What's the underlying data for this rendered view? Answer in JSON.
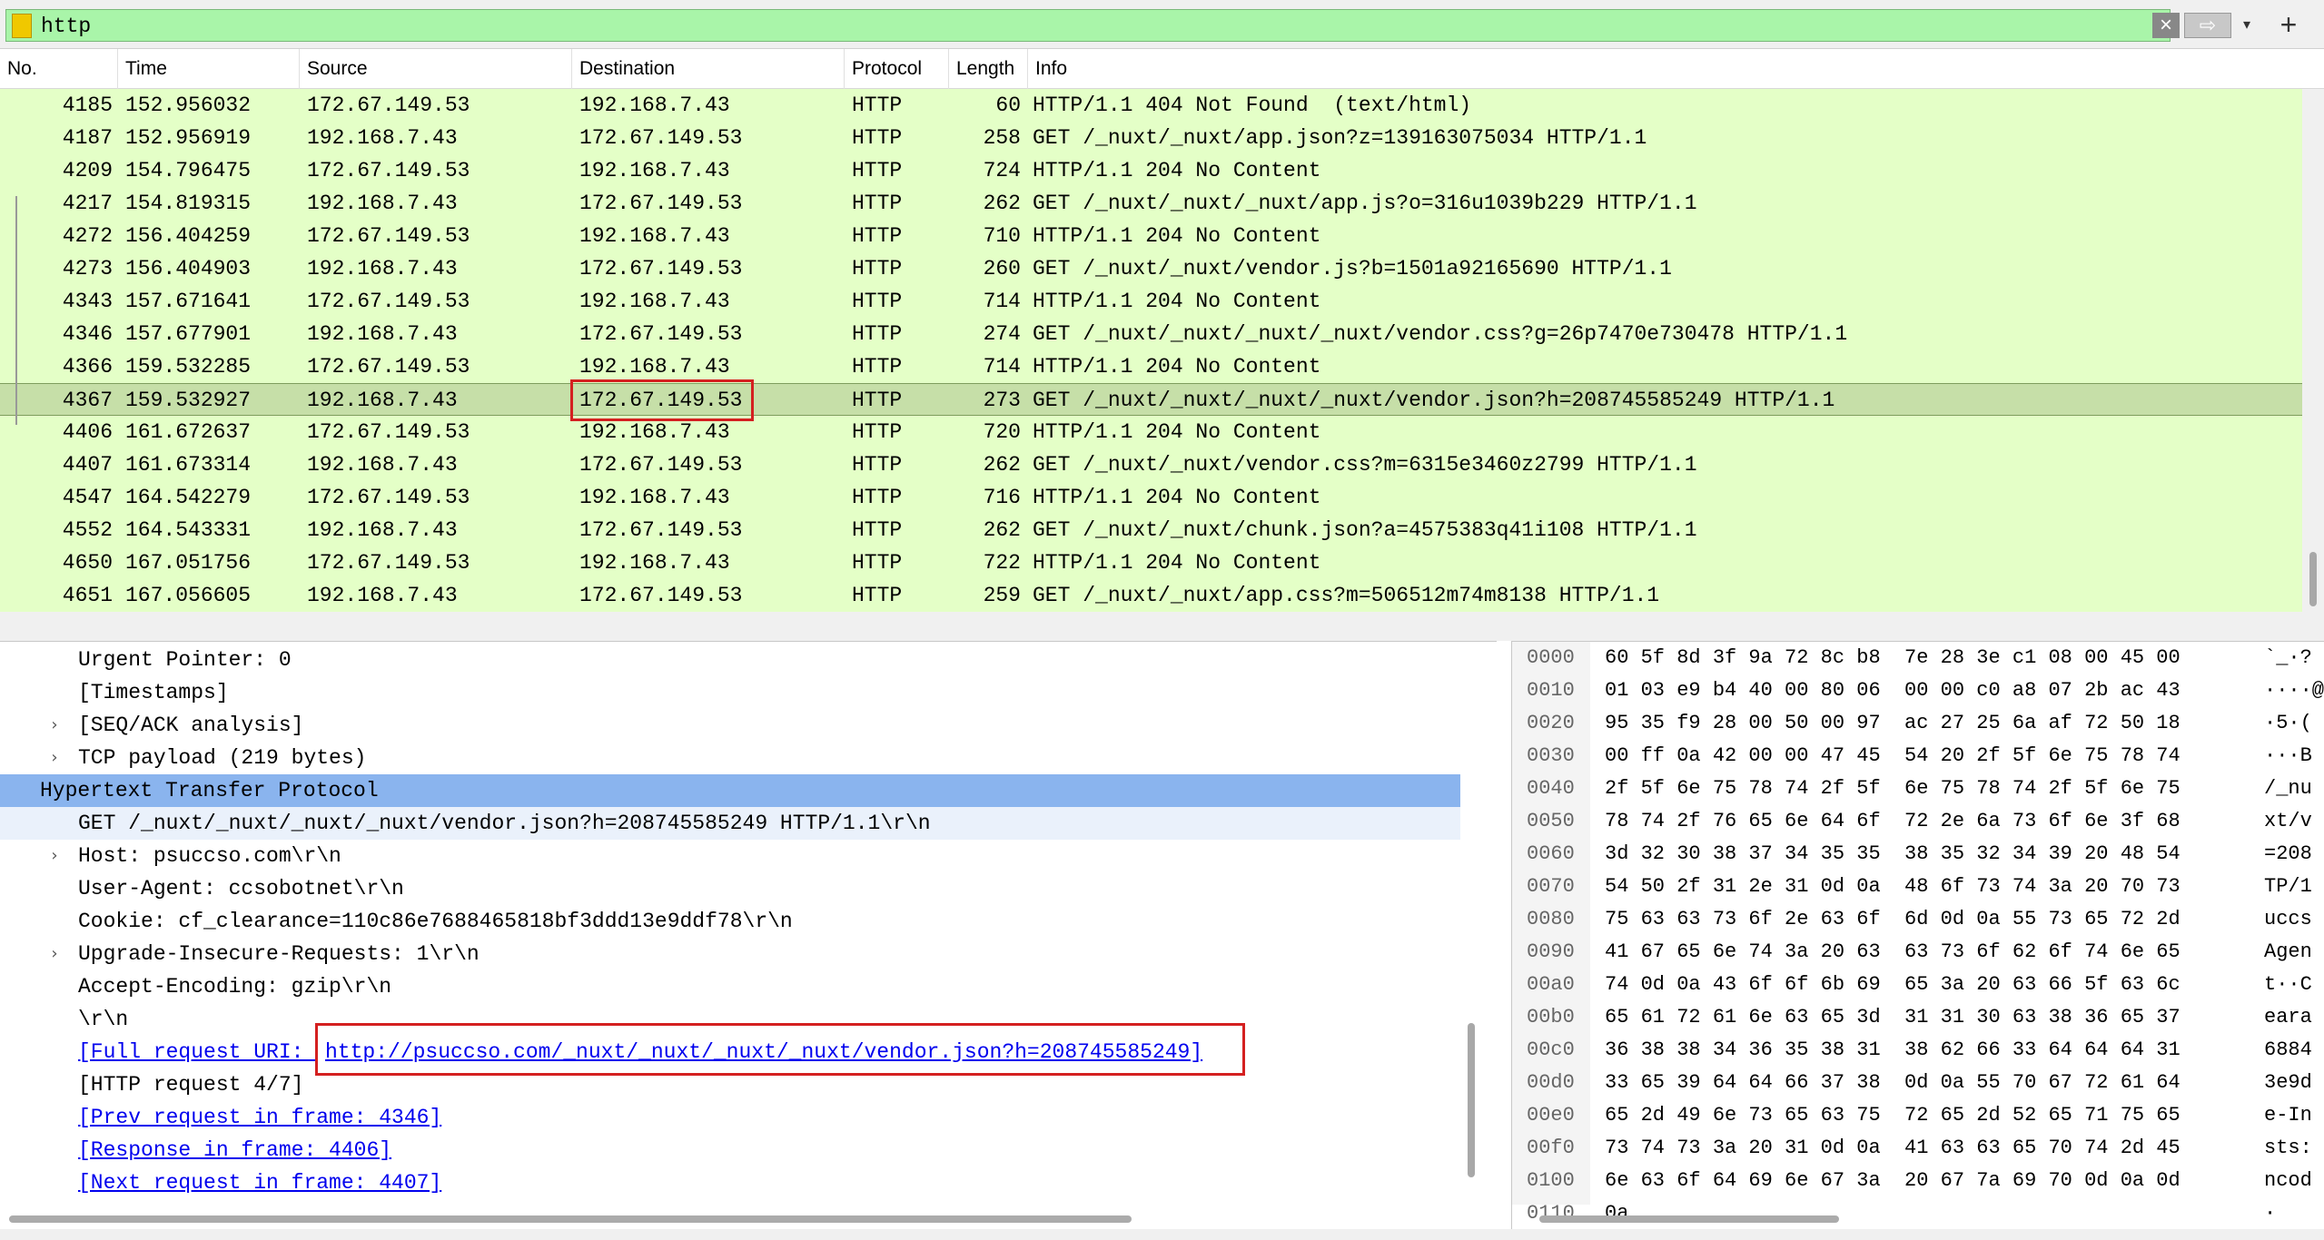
{
  "filter": {
    "value": "http",
    "clear_glyph": "×",
    "apply_glyph": "⇨",
    "dropdown_glyph": "▾",
    "add_glyph": "+"
  },
  "columns": [
    "No.",
    "Time",
    "Source",
    "Destination",
    "Protocol",
    "Length",
    "Info"
  ],
  "packets": [
    {
      "no": "4185",
      "time": "152.956032",
      "src": "172.67.149.53",
      "dst": "192.168.7.43",
      "proto": "HTTP",
      "len": "60",
      "info": "HTTP/1.1 404 Not Found  (text/html)"
    },
    {
      "no": "4187",
      "time": "152.956919",
      "src": "192.168.7.43",
      "dst": "172.67.149.53",
      "proto": "HTTP",
      "len": "258",
      "info": "GET /_nuxt/_nuxt/app.json?z=139163075034 HTTP/1.1"
    },
    {
      "no": "4209",
      "time": "154.796475",
      "src": "172.67.149.53",
      "dst": "192.168.7.43",
      "proto": "HTTP",
      "len": "724",
      "info": "HTTP/1.1 204 No Content"
    },
    {
      "no": "4217",
      "time": "154.819315",
      "src": "192.168.7.43",
      "dst": "172.67.149.53",
      "proto": "HTTP",
      "len": "262",
      "info": "GET /_nuxt/_nuxt/_nuxt/app.js?o=316u1039b229 HTTP/1.1"
    },
    {
      "no": "4272",
      "time": "156.404259",
      "src": "172.67.149.53",
      "dst": "192.168.7.43",
      "proto": "HTTP",
      "len": "710",
      "info": "HTTP/1.1 204 No Content"
    },
    {
      "no": "4273",
      "time": "156.404903",
      "src": "192.168.7.43",
      "dst": "172.67.149.53",
      "proto": "HTTP",
      "len": "260",
      "info": "GET /_nuxt/_nuxt/vendor.js?b=1501a92165690 HTTP/1.1"
    },
    {
      "no": "4343",
      "time": "157.671641",
      "src": "172.67.149.53",
      "dst": "192.168.7.43",
      "proto": "HTTP",
      "len": "714",
      "info": "HTTP/1.1 204 No Content"
    },
    {
      "no": "4346",
      "time": "157.677901",
      "src": "192.168.7.43",
      "dst": "172.67.149.53",
      "proto": "HTTP",
      "len": "274",
      "info": "GET /_nuxt/_nuxt/_nuxt/_nuxt/vendor.css?g=26p7470e730478 HTTP/1.1"
    },
    {
      "no": "4366",
      "time": "159.532285",
      "src": "172.67.149.53",
      "dst": "192.168.7.43",
      "proto": "HTTP",
      "len": "714",
      "info": "HTTP/1.1 204 No Content"
    },
    {
      "no": "4367",
      "time": "159.532927",
      "src": "192.168.7.43",
      "dst": "172.67.149.53",
      "proto": "HTTP",
      "len": "273",
      "info": "GET /_nuxt/_nuxt/_nuxt/_nuxt/vendor.json?h=208745585249 HTTP/1.1"
    },
    {
      "no": "4406",
      "time": "161.672637",
      "src": "172.67.149.53",
      "dst": "192.168.7.43",
      "proto": "HTTP",
      "len": "720",
      "info": "HTTP/1.1 204 No Content"
    },
    {
      "no": "4407",
      "time": "161.673314",
      "src": "192.168.7.43",
      "dst": "172.67.149.53",
      "proto": "HTTP",
      "len": "262",
      "info": "GET /_nuxt/_nuxt/vendor.css?m=6315e3460z2799 HTTP/1.1"
    },
    {
      "no": "4547",
      "time": "164.542279",
      "src": "172.67.149.53",
      "dst": "192.168.7.43",
      "proto": "HTTP",
      "len": "716",
      "info": "HTTP/1.1 204 No Content"
    },
    {
      "no": "4552",
      "time": "164.543331",
      "src": "192.168.7.43",
      "dst": "172.67.149.53",
      "proto": "HTTP",
      "len": "262",
      "info": "GET /_nuxt/_nuxt/chunk.json?a=4575383q41i108 HTTP/1.1"
    },
    {
      "no": "4650",
      "time": "167.051756",
      "src": "172.67.149.53",
      "dst": "192.168.7.43",
      "proto": "HTTP",
      "len": "722",
      "info": "HTTP/1.1 204 No Content"
    },
    {
      "no": "4651",
      "time": "167.056605",
      "src": "192.168.7.43",
      "dst": "172.67.149.53",
      "proto": "HTTP",
      "len": "259",
      "info": "GET /_nuxt/_nuxt/app.css?m=506512m74m8138 HTTP/1.1"
    }
  ],
  "details": {
    "urgent": "Urgent Pointer: 0",
    "timestamps": "[Timestamps]",
    "seqack": "[SEQ/ACK analysis]",
    "payload": "TCP payload (219 bytes)",
    "http": "Hypertext Transfer Protocol",
    "get": "GET /_nuxt/_nuxt/_nuxt/_nuxt/vendor.json?h=208745585249 HTTP/1.1\\r\\n",
    "host": "Host: psuccso.com\\r\\n",
    "ua": "User-Agent: ccsobotnet\\r\\n",
    "cookie": "Cookie: cf_clearance=110c86e7688465818bf3ddd13e9ddf78\\r\\n",
    "upgrade": "Upgrade-Insecure-Requests: 1\\r\\n",
    "encoding": "Accept-Encoding: gzip\\r\\n",
    "crlf": "\\r\\n",
    "full_uri_label": "[Full request URI: ",
    "full_uri_value": "http://psuccso.com/_nuxt/_nuxt/_nuxt/_nuxt/vendor.json?h=208745585249]",
    "http_request": "[HTTP request 4/7]",
    "prev": "[Prev request in frame: 4346]",
    "response": "[Response in frame: 4406]",
    "next": "[Next request in frame: 4407]"
  },
  "hex": [
    {
      "off": "0000",
      "bytes": "60 5f 8d 3f 9a 72 8c b8  7e 28 3e c1 08 00 45 00",
      "ascii": "`_·?"
    },
    {
      "off": "0010",
      "bytes": "01 03 e9 b4 40 00 80 06  00 00 c0 a8 07 2b ac 43",
      "ascii": "····@"
    },
    {
      "off": "0020",
      "bytes": "95 35 f9 28 00 50 00 97  ac 27 25 6a af 72 50 18",
      "ascii": "·5·("
    },
    {
      "off": "0030",
      "bytes": "00 ff 0a 42 00 00 47 45  54 20 2f 5f 6e 75 78 74",
      "ascii": "···B"
    },
    {
      "off": "0040",
      "bytes": "2f 5f 6e 75 78 74 2f 5f  6e 75 78 74 2f 5f 6e 75",
      "ascii": "/_nu"
    },
    {
      "off": "0050",
      "bytes": "78 74 2f 76 65 6e 64 6f  72 2e 6a 73 6f 6e 3f 68",
      "ascii": "xt/v"
    },
    {
      "off": "0060",
      "bytes": "3d 32 30 38 37 34 35 35  38 35 32 34 39 20 48 54",
      "ascii": "=208"
    },
    {
      "off": "0070",
      "bytes": "54 50 2f 31 2e 31 0d 0a  48 6f 73 74 3a 20 70 73",
      "ascii": "TP/1"
    },
    {
      "off": "0080",
      "bytes": "75 63 63 73 6f 2e 63 6f  6d 0d 0a 55 73 65 72 2d",
      "ascii": "uccs"
    },
    {
      "off": "0090",
      "bytes": "41 67 65 6e 74 3a 20 63  63 73 6f 62 6f 74 6e 65",
      "ascii": "Agen"
    },
    {
      "off": "00a0",
      "bytes": "74 0d 0a 43 6f 6f 6b 69  65 3a 20 63 66 5f 63 6c",
      "ascii": "t··C"
    },
    {
      "off": "00b0",
      "bytes": "65 61 72 61 6e 63 65 3d  31 31 30 63 38 36 65 37",
      "ascii": "eara"
    },
    {
      "off": "00c0",
      "bytes": "36 38 38 34 36 35 38 31  38 62 66 33 64 64 64 31",
      "ascii": "6884"
    },
    {
      "off": "00d0",
      "bytes": "33 65 39 64 64 66 37 38  0d 0a 55 70 67 72 61 64",
      "ascii": "3e9d"
    },
    {
      "off": "00e0",
      "bytes": "65 2d 49 6e 73 65 63 75  72 65 2d 52 65 71 75 65",
      "ascii": "e-In"
    },
    {
      "off": "00f0",
      "bytes": "73 74 73 3a 20 31 0d 0a  41 63 63 65 70 74 2d 45",
      "ascii": "sts:"
    },
    {
      "off": "0100",
      "bytes": "6e 63 6f 64 69 6e 67 3a  20 67 7a 69 70 0d 0a 0d",
      "ascii": "ncod"
    },
    {
      "off": "0110",
      "bytes": "0a",
      "ascii": "·"
    }
  ]
}
